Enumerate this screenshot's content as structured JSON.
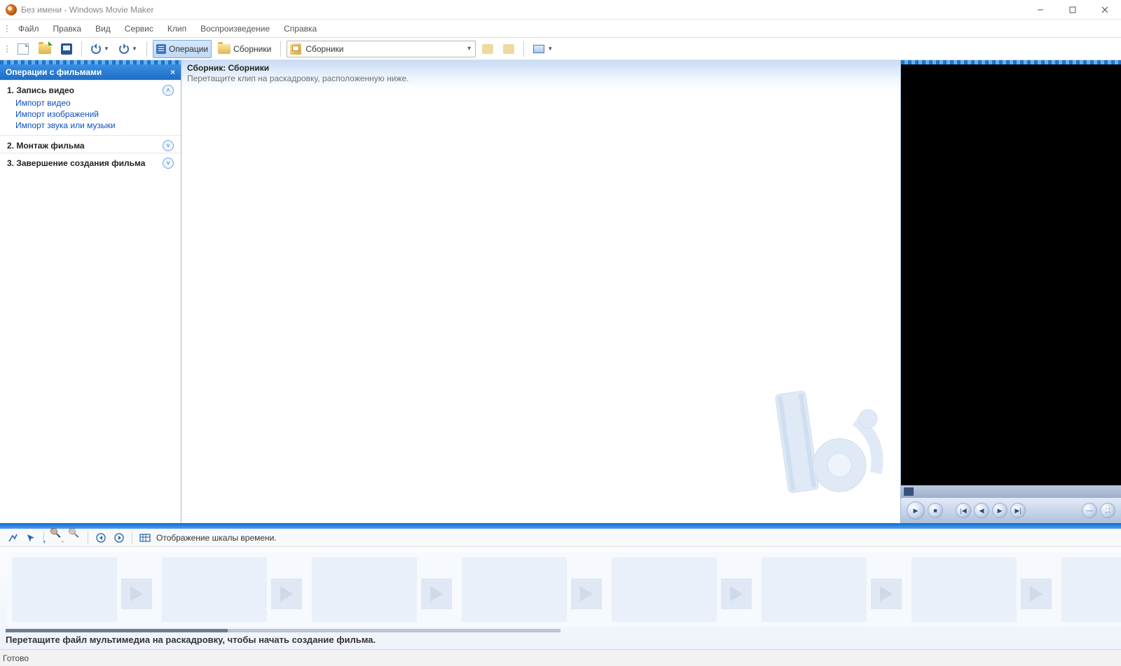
{
  "window": {
    "title": "Без имени - Windows Movie Maker"
  },
  "menu": {
    "file": "Файл",
    "edit": "Правка",
    "view": "Вид",
    "tools": "Сервис",
    "clip": "Клип",
    "play": "Воспроизведение",
    "help": "Справка"
  },
  "toolbar": {
    "operations": "Операции",
    "collections": "Сборники",
    "combo_value": "Сборники"
  },
  "taskpane": {
    "title": "Операции с фильмами",
    "group1": {
      "num": "1.",
      "name": "Запись видео"
    },
    "links": {
      "import_video": "Импорт видео",
      "import_images": "Импорт изображений",
      "import_audio": "Импорт звука или музыки"
    },
    "group2": {
      "num": "2.",
      "name": "Монтаж фильма"
    },
    "group3": {
      "num": "3.",
      "name": "Завершение создания фильма"
    }
  },
  "collection": {
    "title": "Сборник: Сборники",
    "hint": "Перетащите клип на раскадровку, расположенную ниже."
  },
  "storyboard_toolbar": {
    "timeline_toggle": "Отображение шкалы времени."
  },
  "storyboard": {
    "hint": "Перетащите файл мультимедиа на раскадровку, чтобы начать создание фильма."
  },
  "status": {
    "ready": "Готово"
  }
}
